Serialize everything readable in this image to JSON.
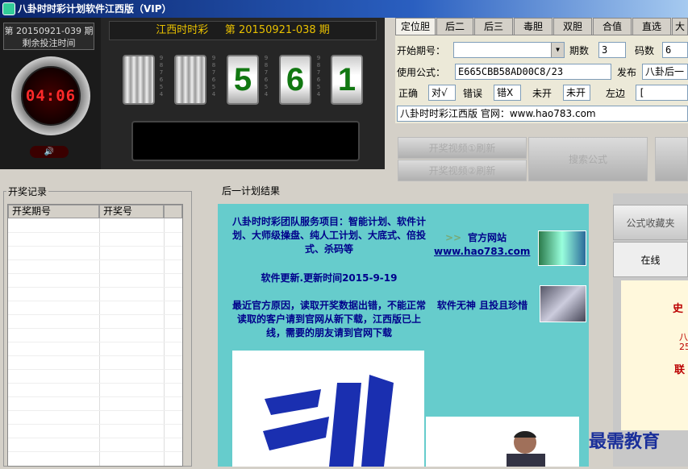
{
  "window": {
    "title": "八卦时时彩计划软件江西版（VIP）"
  },
  "countdown": {
    "next_issue": "第 20150921-039 期",
    "remaining_label": "剩余投注时间",
    "time": "04:06",
    "speaker_glyph": "🔊"
  },
  "lottery": {
    "name": "江西时时彩",
    "issue": "第 20150921-038 期",
    "digits": [
      "5",
      "6",
      "1"
    ]
  },
  "tabs": [
    "定位胆",
    "后二",
    "后三",
    "毒胆",
    "双胆",
    "合值",
    "直选",
    "大"
  ],
  "form": {
    "start_issue_label": "开始期号：",
    "start_issue_value": "",
    "periods_label": "期数",
    "periods_value": "3",
    "codes_label": "码数",
    "codes_value": "6",
    "formula_label": "使用公式：",
    "formula_value": "E665CBB58AD00C8/23",
    "publish_label": "发布",
    "publish_value": "八卦后一",
    "correct_label": "正确",
    "correct_value": "对√",
    "wrong_label": "错误",
    "wrong_value": "错X",
    "unopened_label": "未开",
    "unopened_value": "未开",
    "left_label": "左边",
    "left_value": "[",
    "site_value": "八卦时时彩江西版 官网：www.hao783.com"
  },
  "buttons": {
    "video1": "开奖视频①刷新",
    "video2": "开奖视频②刷新",
    "search_formula": "搜索公式",
    "favorites": "公式收藏夹",
    "online": "在线"
  },
  "history": {
    "title": "开奖记录",
    "columns": [
      "开奖期号",
      "开奖号"
    ]
  },
  "results": {
    "title": "后一计划结果",
    "services": "八卦时时彩团队服务项目：智能计划、软件计划、大师级操盘、纯人工计划、大底式、倍投式、杀码等",
    "update": "软件更新.更新时间2015-9-19",
    "notice": "最近官方原因，读取开奖数据出错，不能正常读取的客户请到官网从新下载，江西版已上线，需要的朋友请到官网下载",
    "site_arrow": ">>",
    "site_label": "官方网站",
    "site_url": "www.hao783.com",
    "motto": "软件无神  且投且珍惜"
  },
  "right_side": {
    "text1": "史",
    "text2": "八",
    "text3": "25",
    "text4": "联"
  },
  "watermark": "最需教育"
}
